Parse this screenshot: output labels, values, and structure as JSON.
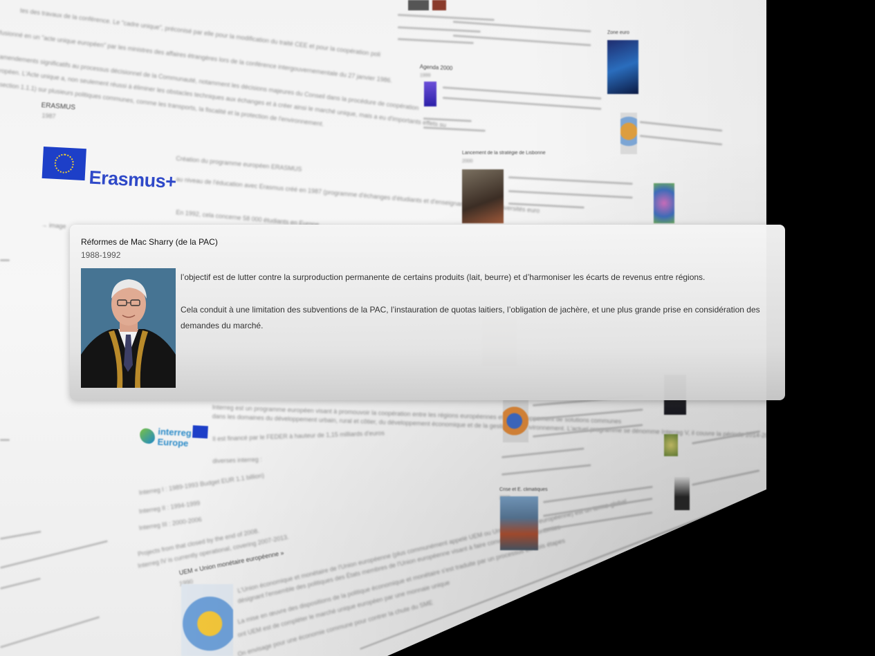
{
  "background": {
    "erasmus": {
      "heading": "ERASMUS",
      "year": "1987",
      "logo_text": "Erasmus+",
      "desc1": "Création du programme européen ERASMUS",
      "desc2": "au niveau de l'éducation avec Erasmus créé en 1987 (programme d'échanges d'étudiants et d'enseignants entre les universités euro",
      "desc3": "En 1992, cela concerne 58 000 étudiants en Europe",
      "link": "→ image"
    },
    "top_texts": [
      "tes des travaux de la conférence. Le \"cadre unique\", préconisé par elle pour la modification du traité CEE et pour la coopération poli",
      "fusionné en un \"acte unique européen\" par les ministres des affaires étrangères lors de la conférence intergouvernementale du 27 janvier 1986.",
      "amendements significatifs au processus décisionnel de la Communauté, notamment les décisions majeures du Conseil dans la procédure de coopération",
      "ropéen. L'Acte unique a, non seulement réussi à éliminer les obstacles techniques aux échanges et à créer ainsi le marché unique, mais a eu d'importants effets su",
      "section 1.1.1) sur plusieurs politiques communes, comme les transports, la fiscalité et la protection de l'environnement."
    ],
    "interreg": {
      "logo_text": "interreg Europe",
      "desc1": "Interreg est un programme européen visant à promouvoir la coopération entre les régions européennes et le développement de solutions communes",
      "desc2": "dans les domaines du développement urbain, rural et côtier, du développement économique et de la gestion de l'environnement. L'actuel programme se dénomme Interreg V, il couvre la période 2014-2020",
      "desc3": "Il est financé par le FEDER à hauteur de 1,15 milliards d'euros",
      "desc4": "diverses interreg :",
      "list": [
        "Interreg I : 1989-1993 Budget EUR 1.1 billion)",
        "Interreg II : 1994-1999",
        "Interreg III : 2000-2006"
      ],
      "desc5": "Projects from that closed by the end of 2008.",
      "desc6": "Interreg IV is currently operational, covering 2007-2013."
    },
    "uem": {
      "title": "UEM « Union monétaire européenne »",
      "year": "1990",
      "desc1": "L'Union économique et monétaire de l'Union européenne (plus communément appelé UEM ou Union monétaire européenne) est un terme global",
      "desc2": "désignant l'ensemble des politiques des États membres de l'Union européenne visant à faire converger leurs économies",
      "desc3": "La mise en œuvre des dispositions de la politique économique et monétaire s'est traduite par un processus en trois étapes",
      "desc4": "ont UEM est de compléter le marché unique européen par une monnaie unique",
      "desc5": "On envisage pour une économie commune pour contrer la chute du SME"
    },
    "right": {
      "agenda_title": "Agenda 2000",
      "agenda_year": "1999",
      "lisbon_title": "Lancement de la stratégie de Lisbonne",
      "lisbon_year": "2000",
      "euro_title": "Zone euro",
      "crisis_title": "Crise et E. climatiques",
      "crisis_year": "2008"
    }
  },
  "popup": {
    "title": "Réformes de Mac Sharry (de la PAC)",
    "date": "1988-1992",
    "photo_alt": "portrait",
    "paragraphs": [
      "l’objectif est de lutter contre la surproduction permanente de certains produits (lait, beurre) et d’harmoniser les écarts de revenus entre régions.",
      "Cela conduit à une limitation des subventions de la PAC, l’instauration de quotas laitiers, l’obligation de jachère, et une plus grande prise en considération des demandes du marché."
    ]
  }
}
